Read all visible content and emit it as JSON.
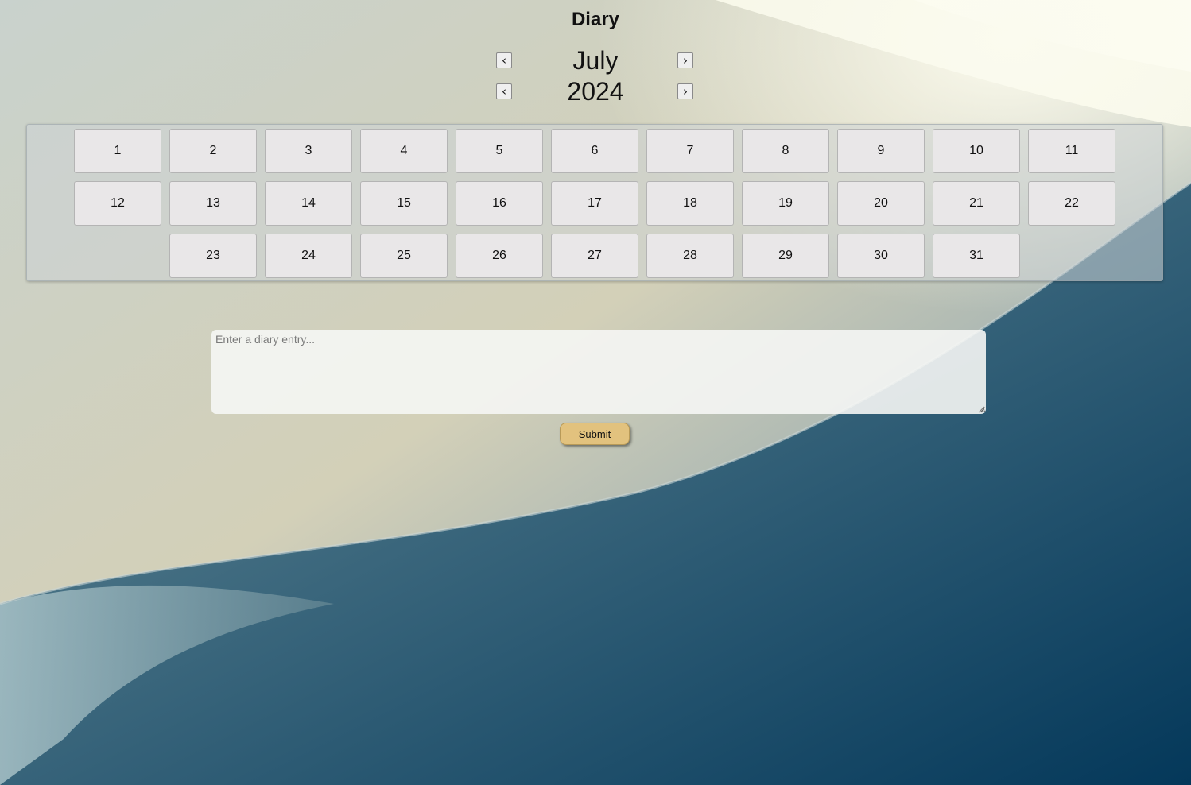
{
  "header": {
    "title": "Diary"
  },
  "month_nav": {
    "label": "July",
    "prev_symbol": "‹",
    "next_symbol": "›"
  },
  "year_nav": {
    "label": "2024",
    "prev_symbol": "‹",
    "next_symbol": "›"
  },
  "calendar": {
    "days": [
      "1",
      "2",
      "3",
      "4",
      "5",
      "6",
      "7",
      "8",
      "9",
      "10",
      "11",
      "12",
      "13",
      "14",
      "15",
      "16",
      "17",
      "18",
      "19",
      "20",
      "21",
      "22",
      "23",
      "24",
      "25",
      "26",
      "27",
      "28",
      "29",
      "30",
      "31"
    ]
  },
  "entry": {
    "placeholder": "Enter a diary entry...",
    "value": ""
  },
  "submit": {
    "label": "Submit"
  },
  "colors": {
    "submit_bg": "#e2c27e",
    "day_bg": "#e9e7e8"
  }
}
